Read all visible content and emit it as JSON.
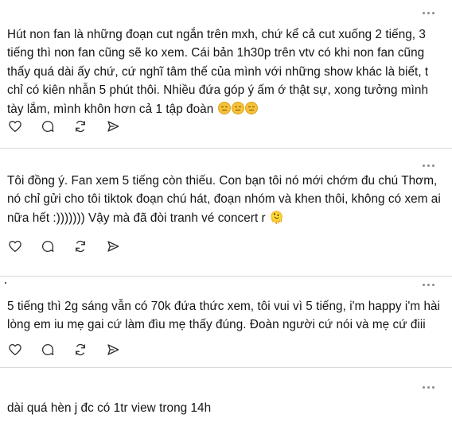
{
  "posts": [
    {
      "text": "Hút non fan là những đoạn cut ngắn trên mxh, chứ kể cả cut xuống 2 tiếng, 3 tiếng thì non fan cũng sẽ ko xem. Cái bản 1h30p trên vtv có khi non fan cũng thấy quá dài ấy chứ, cứ nghĩ tâm thế của mình với những show khác là biết, t chỉ có kiên nhẫn 5 phút thôi. Nhiều đứa góp ý ấm ớ thật sự, xong tưởng mình tày lắm, mình khôn hơn cả 1 tập đoàn",
      "emojis": [
        "pensive-face-emoji",
        "pensive-face-emoji",
        "pensive-face-emoji"
      ]
    },
    {
      "text": "Tôi đồng ý. Fan xem 5 tiếng còn thiếu. Con bạn tôi nó mới chớm đu chú Thơm, nó chỉ gửi cho tôi tiktok đoạn chú hát, đoạn nhóm và khen thôi, không có xem ai nữa hết :))))))) Vậy mà đã đòi tranh vé concert r 🫠"
    },
    {
      "text": "5 tiếng thì 2g sáng vẫn có 70k đứa thức xem, tôi vui vì 5 tiếng, i'm happy i'm hài lòng em iu mẹ gai cứ làm đìu mẹ thấy đúng. Đoàn người cứ nói và mẹ cứ điii"
    },
    {
      "text": "dài quá hèn j đc có 1tr view trong 14h"
    }
  ],
  "actions": {
    "icons": [
      "heart-icon",
      "comment-icon",
      "repost-icon",
      "share-icon"
    ]
  },
  "colors": {
    "text": "#141414",
    "divider": "#d9d9d9",
    "icon": "#2a2a2a",
    "more": "#8a8a8a"
  }
}
